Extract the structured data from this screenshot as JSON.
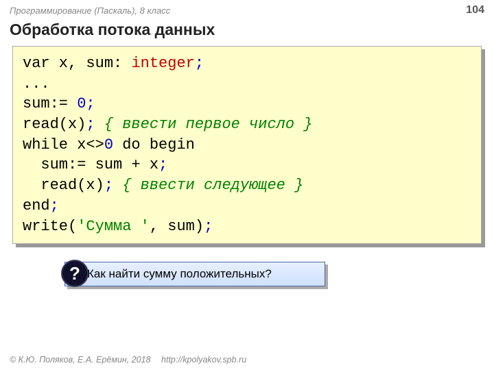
{
  "header": {
    "course": "Программирование (Паскаль), 8 класс",
    "page": "104"
  },
  "title": "Обработка потока данных",
  "code": {
    "l1a": "var x, sum: ",
    "l1b": "integer",
    "l1c": ";",
    "l2": "...",
    "l3a": "sum:= ",
    "l3b": "0",
    "l3c": ";",
    "l4a": "read(x)",
    "l4b": ";",
    "l4c": " { ввести первое число }",
    "l5a": "while x<>",
    "l5b": "0",
    "l5c": " do begin",
    "l6a": "  sum:= sum + x",
    "l6b": ";",
    "l7a": "  read(x)",
    "l7b": ";",
    "l7c": " { ввести следующее }",
    "l8a": "end",
    "l8b": ";",
    "l9a": "write(",
    "l9b": "'Сумма '",
    "l9c": ", sum)",
    "l9d": ";"
  },
  "question": {
    "mark": "?",
    "text": "Как найти сумму положительных?"
  },
  "footer": {
    "copyright": "© К.Ю. Поляков, Е.А. Ерёмин, 2018",
    "link": "http://kpolyakov.spb.ru"
  }
}
